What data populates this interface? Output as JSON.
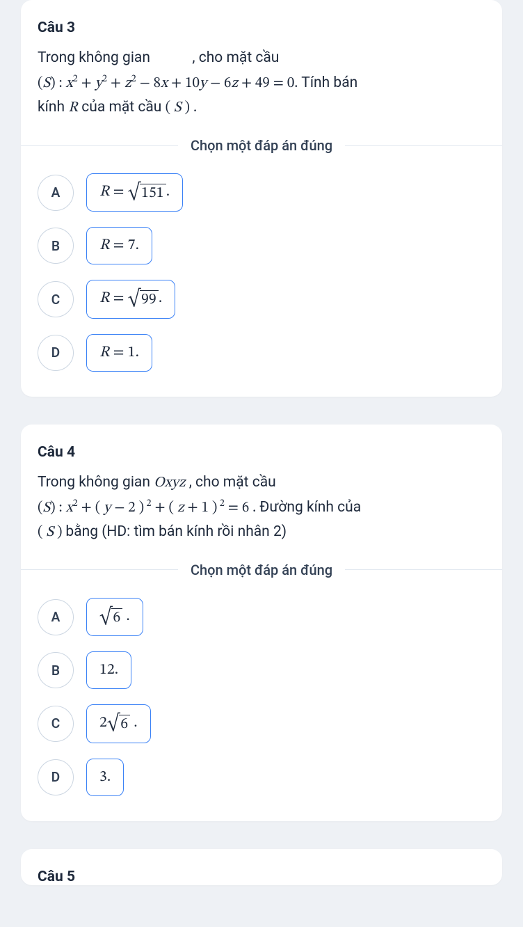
{
  "q3": {
    "title": "Câu 3",
    "line1a": "Trong không gian",
    "line1b": ", cho mặt cầu",
    "eq_open": "(",
    "eq_S": "S",
    "eq_close_colon": ") : ",
    "eq_x": "x",
    "eq_plus1": " + ",
    "eq_y": "y",
    "eq_plus2": " + ",
    "eq_z": "z",
    "eq_minus8": " − 8",
    "eq_x2": "x",
    "eq_plus10": " + 10",
    "eq_y2": "y",
    "eq_minus6": " − 6",
    "eq_z2": "z",
    "eq_plus49": " + 49 = 0.",
    "tail": " Tính bán",
    "line3a": "kính ",
    "line3R": "R",
    "line3b": " của mặt cầu ",
    "line3paren": "( ",
    "line3S": "S",
    "line3close": " ) .",
    "prompt": "Chọn một đáp án đúng",
    "optA": {
      "letter": "A",
      "pre": "R",
      "eq": " = ",
      "rad": "√",
      "arg": "151",
      "post": "."
    },
    "optB": {
      "letter": "B",
      "pre": "R",
      "eq": " = 7."
    },
    "optC": {
      "letter": "C",
      "pre": "R",
      "eq": " = ",
      "rad": "√",
      "arg": "99",
      "post": "."
    },
    "optD": {
      "letter": "D",
      "pre": "R",
      "eq": " = 1."
    }
  },
  "q4": {
    "title": "Câu 4",
    "line1a": "Trong không gian ",
    "line1O": "O",
    "line1xyz": "xyz",
    "line1b": " ,  cho mặt cầu",
    "eq_open": "(",
    "eq_S": "S",
    "eq_close_colon": ") : ",
    "eq_x": "x",
    "eq_plus1": " + ( ",
    "eq_y": "y",
    "eq_minus2": " − 2 )",
    "eq_plus2": " + ( ",
    "eq_z": "z",
    "eq_plus1b": " + 1 )",
    "eq_eq6": " = 6 .",
    "tail": " Đường kính của",
    "line3open": "( ",
    "line3S": "S",
    "line3close": " ) ",
    "line3b": " bằng (HD: tìm bán kính rồi nhân 2)",
    "prompt": "Chọn một đáp án đúng",
    "optA": {
      "letter": "A",
      "rad": "√",
      "arg": "6",
      "post": " ."
    },
    "optB": {
      "letter": "B",
      "text": "12."
    },
    "optC": {
      "letter": "C",
      "pre": "2",
      "rad": "√",
      "arg": "6",
      "post": " ."
    },
    "optD": {
      "letter": "D",
      "text": "3."
    }
  },
  "q5": {
    "title": "Câu 5"
  }
}
